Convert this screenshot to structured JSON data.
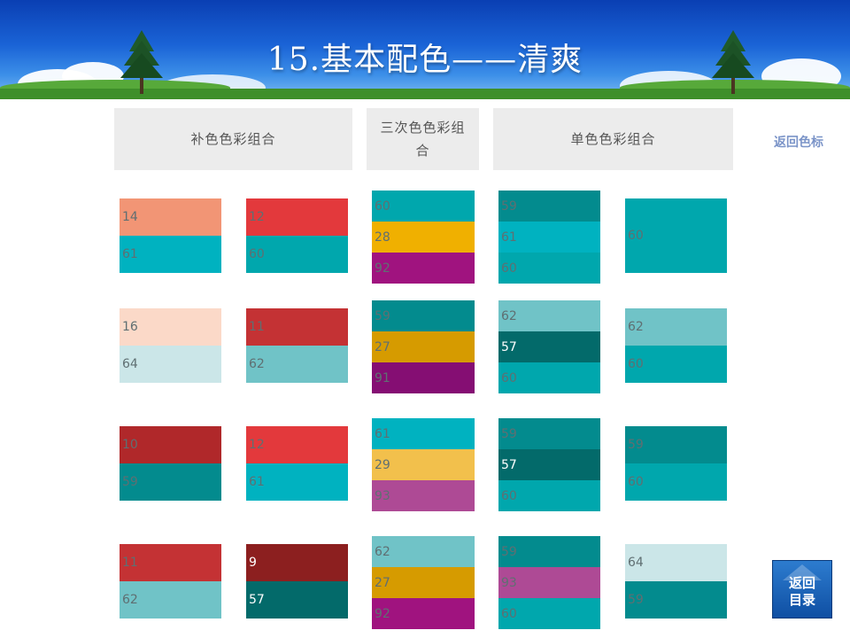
{
  "page": {
    "title": "15.基本配色——清爽",
    "back_link": "返回色标",
    "nav_button_line1": "返回",
    "nav_button_line2": "目录"
  },
  "headers": {
    "complementary": "补色色彩组合",
    "triadic_line1": "三次色色彩组",
    "triadic_line2": "合",
    "mono": "单色色彩组合"
  },
  "palette": {
    "9": "#8c1f1f",
    "10": "#b0282a",
    "11": "#c43234",
    "12": "#e3393c",
    "14": "#f29575",
    "16": "#fbd9c8",
    "27": "#d69b00",
    "28": "#f0b000",
    "29": "#f2c04c",
    "57": "#036a6a",
    "59": "#038b8e",
    "60": "#00a7ad",
    "61": "#00b2c0",
    "62": "#70c3c7",
    "64": "#cbe6e8",
    "91": "#850e73",
    "92": "#a0137f",
    "93": "#ae4a95"
  },
  "text_colors": {
    "light": "#ffffff",
    "mid": "#5f6f72",
    "dark": "#333333"
  },
  "swatches": {
    "complementary_a": [
      [
        "14",
        "61"
      ],
      [
        "16",
        "64"
      ],
      [
        "10",
        "59"
      ],
      [
        "11",
        "62"
      ]
    ],
    "complementary_b": [
      [
        "12",
        "60"
      ],
      [
        "11",
        "62"
      ],
      [
        "12",
        "61"
      ],
      [
        "9",
        "57"
      ]
    ],
    "triadic": [
      [
        "60",
        "28",
        "92"
      ],
      [
        "59",
        "27",
        "91"
      ],
      [
        "61",
        "29",
        "93"
      ],
      [
        "62",
        "27",
        "92"
      ]
    ],
    "mono_a": [
      [
        "59",
        "61",
        "60"
      ],
      [
        "62",
        "57",
        "60"
      ],
      [
        "59",
        "57",
        "60"
      ],
      [
        "59",
        "93",
        "60"
      ]
    ],
    "mono_b": [
      [
        "60"
      ],
      [
        "62",
        "60"
      ],
      [
        "59",
        "60"
      ],
      [
        "64",
        "59"
      ]
    ]
  }
}
